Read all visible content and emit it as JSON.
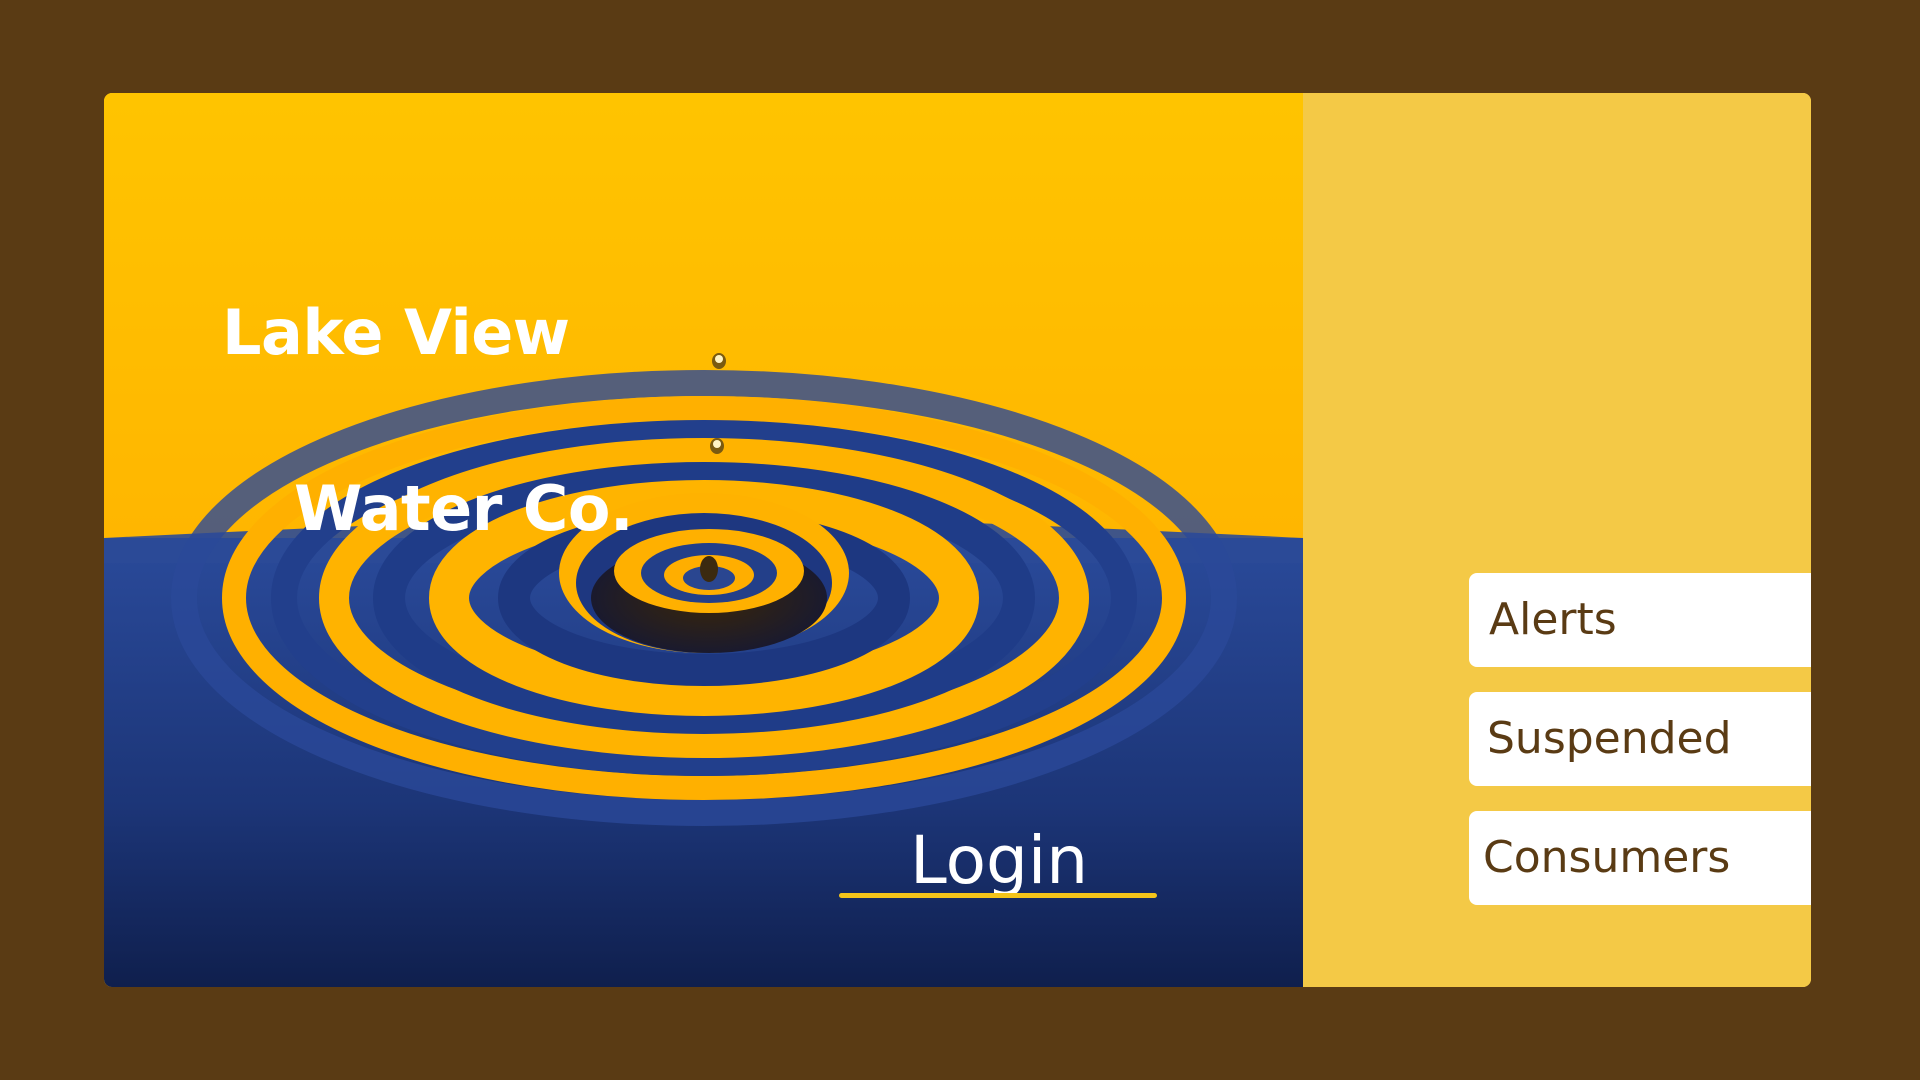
{
  "brand": {
    "line1": "Lake View",
    "line2": "Water Co."
  },
  "login": {
    "label": "Login"
  },
  "nav": {
    "items": [
      {
        "label": "Alerts"
      },
      {
        "label": "Suspended"
      },
      {
        "label": "Consumers"
      }
    ]
  },
  "colors": {
    "background": "#5a3b14",
    "panel": "#f4c946",
    "accent": "#f4c41a",
    "water_blue": "#1e3a7a",
    "sky_orange": "#ffb300",
    "button_text": "#5a3b14"
  },
  "hero_image": {
    "subject": "water-drop-ripple"
  }
}
